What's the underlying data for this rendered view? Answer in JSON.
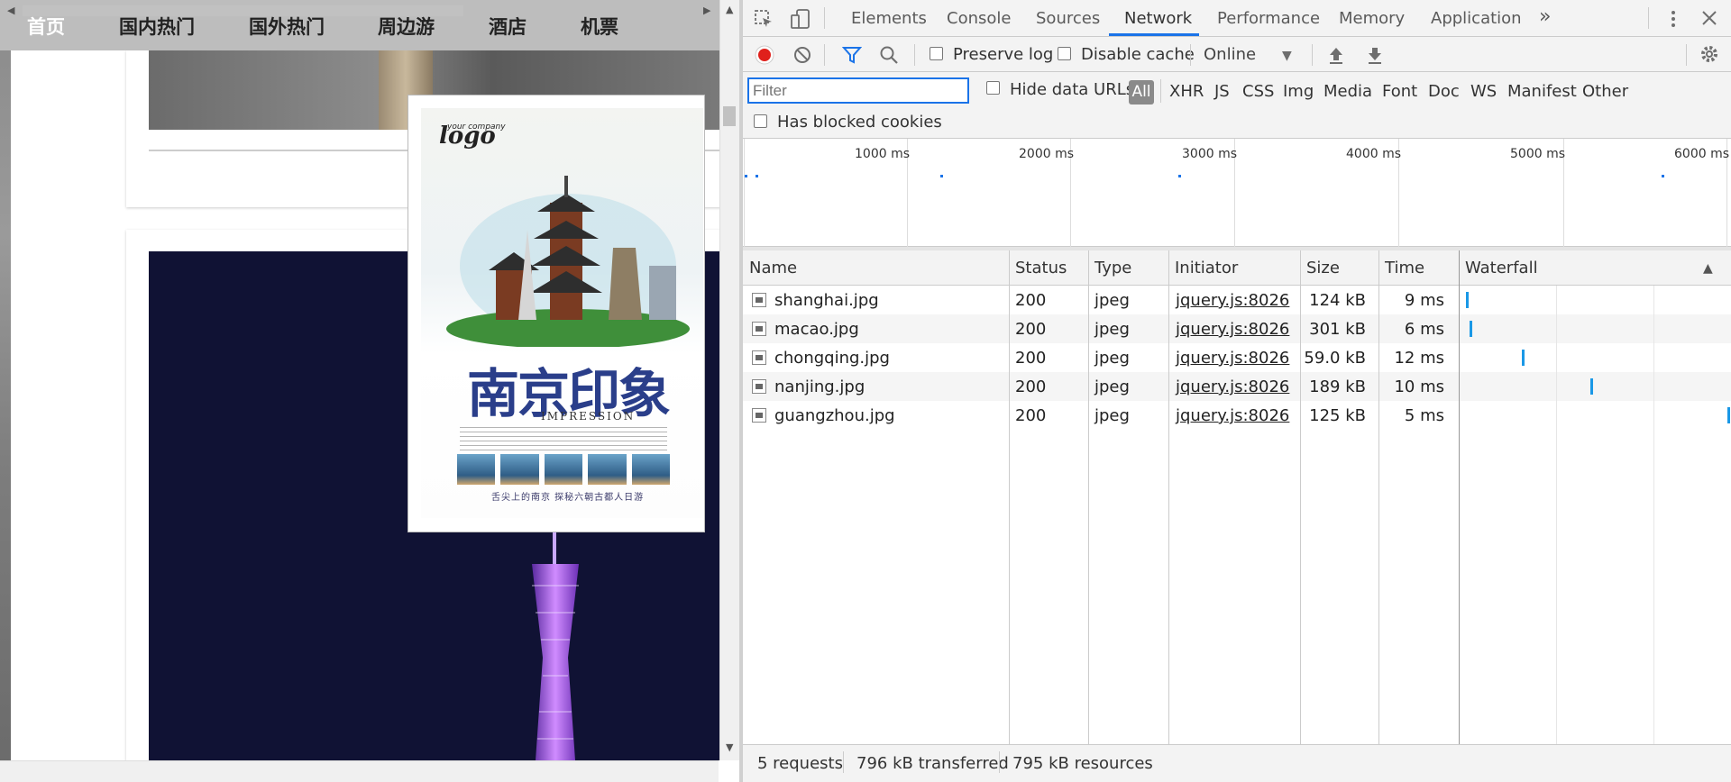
{
  "site": {
    "nav": [
      "首页",
      "国内热门",
      "国外热门",
      "周边游",
      "酒店",
      "机票"
    ],
    "poster": {
      "logo_small": "your company",
      "logo": "logo",
      "title": "南京印象",
      "subtitle": "IMPRESSION",
      "footer": "舌尖上的南京 探秘六朝古都人日游"
    }
  },
  "devtools": {
    "tabs": [
      "Elements",
      "Console",
      "Sources",
      "Network",
      "Performance",
      "Memory",
      "Application"
    ],
    "active_tab": "Network",
    "more": "»",
    "toolbar": {
      "preserve_log": "Preserve log",
      "disable_cache": "Disable cache",
      "throttle": "Online"
    },
    "filter": {
      "placeholder": "Filter",
      "hide_data_urls": "Hide data URLs",
      "types": [
        "All",
        "XHR",
        "JS",
        "CSS",
        "Img",
        "Media",
        "Font",
        "Doc",
        "WS",
        "Manifest",
        "Other"
      ],
      "active_type": "All",
      "has_blocked_cookies": "Has blocked cookies"
    },
    "overview_ticks": [
      "1000 ms",
      "2000 ms",
      "3000 ms",
      "4000 ms",
      "5000 ms",
      "6000 ms"
    ],
    "columns": [
      "Name",
      "Status",
      "Type",
      "Initiator",
      "Size",
      "Time",
      "Waterfall"
    ],
    "requests": [
      {
        "name": "shanghai.jpg",
        "status": "200",
        "type": "jpeg",
        "initiator": "jquery.js:8026",
        "size": "124 kB",
        "time": "9 ms"
      },
      {
        "name": "macao.jpg",
        "status": "200",
        "type": "jpeg",
        "initiator": "jquery.js:8026",
        "size": "301 kB",
        "time": "6 ms"
      },
      {
        "name": "chongqing.jpg",
        "status": "200",
        "type": "jpeg",
        "initiator": "jquery.js:8026",
        "size": "59.0 kB",
        "time": "12 ms"
      },
      {
        "name": "nanjing.jpg",
        "status": "200",
        "type": "jpeg",
        "initiator": "jquery.js:8026",
        "size": "189 kB",
        "time": "10 ms"
      },
      {
        "name": "guangzhou.jpg",
        "status": "200",
        "type": "jpeg",
        "initiator": "jquery.js:8026",
        "size": "125 kB",
        "time": "5 ms"
      }
    ],
    "summary": {
      "requests": "5 requests",
      "transferred": "796 kB transferred",
      "resources": "795 kB resources"
    }
  }
}
